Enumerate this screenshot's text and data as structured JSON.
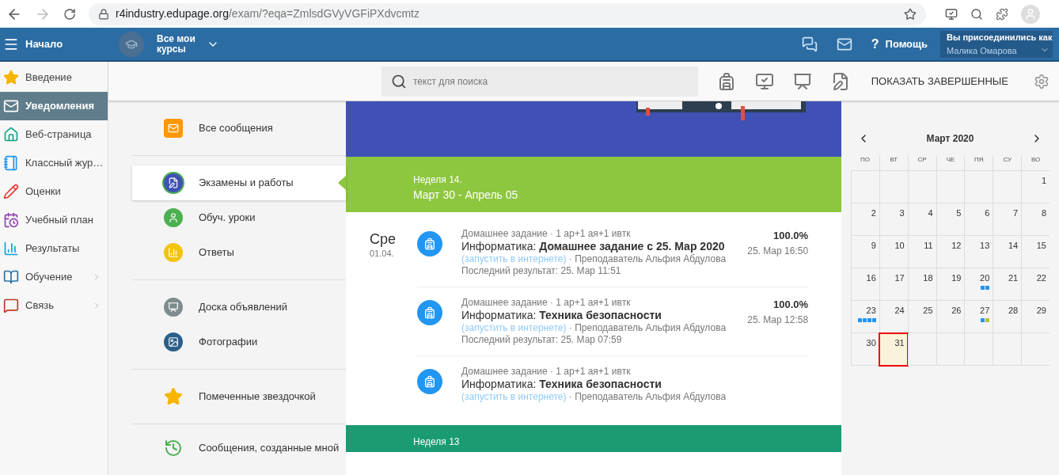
{
  "browser": {
    "url_host": "r4industry.edupage.org",
    "url_path": "/exam/?eqa=ZmlsdGVyVGFiPXdvcmtz"
  },
  "header": {
    "home_label": "Начало",
    "courses_label": "Все мои курсы",
    "help_icon_text": "?",
    "help_label": "Помощь",
    "user_caption": "Вы присоединились как",
    "user_name": "Малика Омарова"
  },
  "sidebar": {
    "items": [
      {
        "label": "Введение",
        "kind": "star",
        "selected": false,
        "has_submenu": false
      },
      {
        "label": "Уведомления",
        "kind": "mail",
        "selected": true,
        "has_submenu": false
      },
      {
        "label": "Веб-страница",
        "kind": "house",
        "selected": false,
        "has_submenu": false
      },
      {
        "label": "Классный жур…",
        "kind": "notebook",
        "selected": false,
        "has_submenu": false
      },
      {
        "label": "Оценки",
        "kind": "grades",
        "selected": false,
        "has_submenu": false
      },
      {
        "label": "Учебный план",
        "kind": "plan",
        "selected": false,
        "has_submenu": false
      },
      {
        "label": "Результаты",
        "kind": "chart",
        "selected": false,
        "has_submenu": false
      },
      {
        "label": "Обучение",
        "kind": "book",
        "selected": false,
        "has_submenu": true
      },
      {
        "label": "Связь",
        "kind": "chat",
        "selected": false,
        "has_submenu": true
      }
    ]
  },
  "toolbar": {
    "search_placeholder": "текст для поиска",
    "show_completed": "ПОКАЗАТЬ ЗАВЕРШЕННЫЕ"
  },
  "categories": {
    "groups": [
      {
        "items": [
          {
            "label": "Все сообщения",
            "kind": "mail",
            "selected": false
          }
        ]
      },
      {
        "items": [
          {
            "label": "Экзамены и работы",
            "kind": "exam",
            "selected": true
          },
          {
            "label": "Обуч. уроки",
            "kind": "person",
            "selected": false
          },
          {
            "label": "Ответы",
            "kind": "chart",
            "selected": false
          }
        ]
      },
      {
        "items": [
          {
            "label": "Доска объявлений",
            "kind": "board",
            "selected": false
          },
          {
            "label": "Фотографии",
            "kind": "photo",
            "selected": false
          }
        ]
      },
      {
        "items": [
          {
            "label": "Помеченные звездочкой",
            "kind": "star",
            "selected": false
          }
        ]
      },
      {
        "items": [
          {
            "label": "Сообщения, созданные мной",
            "kind": "history",
            "selected": false
          }
        ]
      }
    ]
  },
  "feed": {
    "weeks": [
      {
        "title": "Неделя 14.",
        "range": "Март 30 - Апрель 05",
        "color": "#8dc63f",
        "days": [
          {
            "weekday": "Сре",
            "date": "01.04.",
            "entries": [
              {
                "meta": "Домашнее задание · 1 ар+1 ая+1 ивтк",
                "subject": "Информатика:",
                "title": "Домашнее задание с 25. Мар 2020",
                "link": "(запустить в интернете)",
                "teacher": "· Преподаватель Альфия Абдулова",
                "last_result": "Последний результат: 25. Мар 11:51",
                "score": "100.0%",
                "score_date": "25. Мар 16:50"
              },
              {
                "meta": "Домашнее задание · 1 ар+1 ая+1 ивтк",
                "subject": "Информатика:",
                "title": "Техника безопасности",
                "link": "(запустить в интернете)",
                "teacher": "· Преподаватель Альфия Абдулова",
                "last_result": "Последний результат: 25. Мар 07:59",
                "score": "100.0%",
                "score_date": "25. Мар 12:58"
              },
              {
                "meta": "Домашнее задание · 1 ар+1 ая+1 ивтк",
                "subject": "Информатика:",
                "title": "Техника безопасности",
                "link": "(запустить в интернете)",
                "teacher": "· Преподаватель Альфия Абдулова"
              }
            ]
          }
        ]
      },
      {
        "title": "Неделя 13",
        "color": "#1a9b74"
      }
    ]
  },
  "calendar": {
    "title": "Март 2020",
    "weekdays": [
      "ПО",
      "ВТ",
      "СР",
      "ЧЕ",
      "ПЯ",
      "СУ",
      "ВО"
    ],
    "weeks": [
      [
        {
          "kind": "blank"
        },
        {
          "kind": "blank"
        },
        {
          "kind": "blank"
        },
        {
          "kind": "blank"
        },
        {
          "kind": "blank"
        },
        {
          "kind": "blank"
        },
        {
          "kind": "day",
          "day": "1",
          "selected": false
        }
      ],
      [
        {
          "kind": "day",
          "day": "2",
          "selected": false
        },
        {
          "kind": "day",
          "day": "3",
          "selected": false
        },
        {
          "kind": "day",
          "day": "4",
          "selected": false
        },
        {
          "kind": "day",
          "day": "5",
          "selected": false
        },
        {
          "kind": "day",
          "day": "6",
          "selected": false
        },
        {
          "kind": "day",
          "day": "7",
          "selected": false
        },
        {
          "kind": "day",
          "day": "8",
          "selected": false
        }
      ],
      [
        {
          "kind": "day",
          "day": "9",
          "selected": false
        },
        {
          "kind": "day",
          "day": "10",
          "selected": false
        },
        {
          "kind": "day",
          "day": "11",
          "selected": false
        },
        {
          "kind": "day",
          "day": "12",
          "selected": false
        },
        {
          "kind": "day",
          "day": "13",
          "selected": false
        },
        {
          "kind": "day",
          "day": "14",
          "selected": false
        },
        {
          "kind": "day",
          "day": "15",
          "selected": false
        }
      ],
      [
        {
          "kind": "day",
          "day": "16",
          "selected": false
        },
        {
          "kind": "day",
          "day": "17",
          "selected": false
        },
        {
          "kind": "day",
          "day": "18",
          "selected": false
        },
        {
          "kind": "day",
          "day": "19",
          "selected": false
        },
        {
          "kind": "day",
          "day": "20",
          "selected": false,
          "dots": [
            {
              "color": "#2196f3"
            },
            {
              "color": "#2196f3"
            }
          ]
        },
        {
          "kind": "day",
          "day": "21",
          "selected": false
        },
        {
          "kind": "day",
          "day": "22",
          "selected": false
        }
      ],
      [
        {
          "kind": "day",
          "day": "23",
          "selected": false,
          "dots": [
            {
              "color": "#2196f3"
            },
            {
              "color": "#2196f3"
            },
            {
              "color": "#2196f3"
            },
            {
              "color": "#2196f3"
            }
          ]
        },
        {
          "kind": "day",
          "day": "24",
          "selected": false
        },
        {
          "kind": "day",
          "day": "25",
          "selected": false
        },
        {
          "kind": "day",
          "day": "26",
          "selected": false
        },
        {
          "kind": "day",
          "day": "27",
          "selected": false,
          "dots": [
            {
              "color": "#2196f3"
            },
            {
              "color": "#b5c334"
            }
          ]
        },
        {
          "kind": "day",
          "day": "28",
          "selected": false
        },
        {
          "kind": "day",
          "day": "29",
          "selected": false
        }
      ],
      [
        {
          "kind": "day",
          "day": "30",
          "selected": false
        },
        {
          "kind": "day",
          "day": "31",
          "selected": true
        },
        {
          "kind": "blank"
        },
        {
          "kind": "blank"
        },
        {
          "kind": "blank"
        },
        {
          "kind": "blank"
        },
        {
          "kind": "blank"
        }
      ]
    ]
  }
}
